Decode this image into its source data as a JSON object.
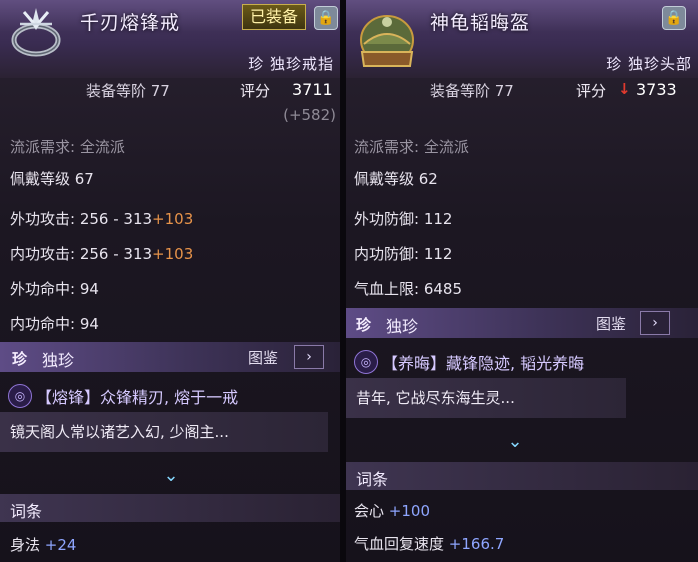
{
  "left": {
    "name": "千刃熔锋戒",
    "equipped_badge": "已装备",
    "type": "珍 独珍戒指",
    "gear_score_label": "装备等阶 77",
    "score_label": "评分",
    "score_value": "3711",
    "score_delta": "(+582)",
    "school_req": "流派需求: 全流派",
    "wear_level": "佩戴等级 67",
    "stats": [
      {
        "label": "外功攻击: 256 - 313",
        "bonus": "+103"
      },
      {
        "label": "内功攻击: 256 - 313",
        "bonus": "+103"
      },
      {
        "label": "外功命中: 94",
        "bonus": ""
      },
      {
        "label": "内功命中: 94",
        "bonus": ""
      }
    ],
    "rarity_tag": "珍",
    "rarity_label": "独珍",
    "codex_label": "图鉴",
    "effect_text": "【熔锋】众锋精刃, 熔于一戒",
    "desc_text": "镜天阁人常以诸艺入幻, 少阁主...",
    "affix_header": "词条",
    "affixes": [
      {
        "label": "身法",
        "value": "+24"
      }
    ]
  },
  "right": {
    "name": "神龟韬晦盔",
    "type": "珍 独珍头部",
    "gear_score_label": "装备等阶 77",
    "score_label": "评分",
    "score_value": "3733",
    "down_arrow": "↓",
    "school_req": "流派需求: 全流派",
    "wear_level": "佩戴等级 62",
    "stats": [
      {
        "label": "外功防御: 112"
      },
      {
        "label": "内功防御: 112"
      },
      {
        "label": "气血上限: 6485"
      }
    ],
    "rarity_tag": "珍",
    "rarity_label": "独珍",
    "codex_label": "图鉴",
    "effect_text": "【养晦】藏锋隐迹, 韬光养晦",
    "desc_text": "昔年, 它战尽东海生灵...",
    "affix_header": "词条",
    "affixes": [
      {
        "label": "会心",
        "value": "+100"
      },
      {
        "label": "气血回复速度",
        "value": "+166.7"
      }
    ]
  },
  "background_slots": [
    "113",
    "96"
  ],
  "colors": {
    "accent_purple": "#5e4c86",
    "bonus_orange": "#e7934a",
    "affix_blue": "#8fa6ff",
    "score_down": "#e03a2e"
  }
}
